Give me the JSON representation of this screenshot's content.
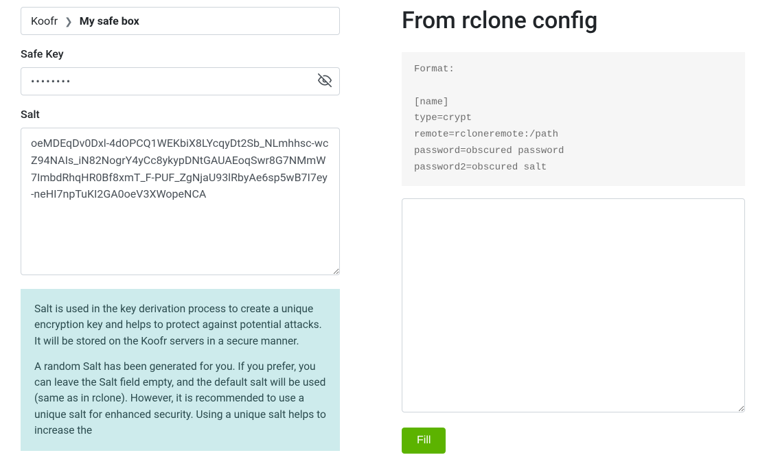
{
  "left": {
    "breadcrumb": {
      "root": "Koofr",
      "leaf": "My safe box"
    },
    "safekey": {
      "label": "Safe Key",
      "value": "••••••••"
    },
    "salt": {
      "label": "Salt",
      "value": "oeMDEqDv0Dxl-4dOPCQ1WEKbiX8LYcqyDt2Sb_NLmhhsc-wcZ94NAIs_iN82NogrY4yCc8ykypDNtGAUAEoqSwr8G7NMmW7ImbdRhqHR0Bf8xmT_F-PUF_ZgNjaU93lRbyAe6sp5wB7I7ey-neHI7npTuKI2GA0oeV3XWopeNCA"
    },
    "info": {
      "p1": "Salt is used in the key derivation process to create a unique encryption key and helps to protect against potential attacks. It will be stored on the Koofr servers in a secure manner.",
      "p2": "A random Salt has been generated for you. If you prefer, you can leave the Salt field empty, and the default salt will be used (same as in rclone). However, it is recommended to use a unique salt for enhanced security. Using a unique salt helps to increase the"
    }
  },
  "right": {
    "title": "From rclone config",
    "format_block": "Format:\n\n[name]\ntype=crypt\nremote=rcloneremote:/path\npassword=obscured password\npassword2=obscured salt",
    "config_value": "",
    "fill_label": "Fill"
  }
}
